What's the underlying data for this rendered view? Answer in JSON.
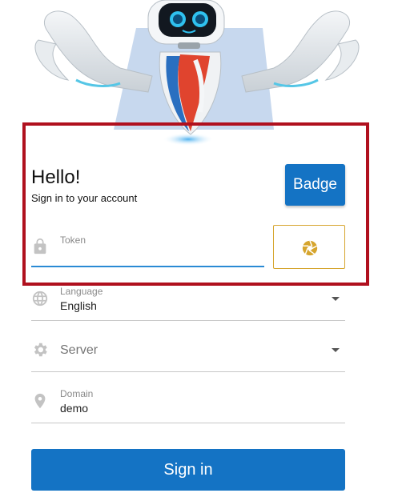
{
  "header": {
    "greeting": "Hello!",
    "subtitle": "Sign in to your account"
  },
  "badge_button": {
    "label": "Badge"
  },
  "token_field": {
    "label": "Token",
    "value": "",
    "icon": "lock-icon"
  },
  "camera_button": {
    "icon": "camera-shutter-icon"
  },
  "language_field": {
    "label": "Language",
    "value": "English",
    "icon": "globe-icon"
  },
  "server_field": {
    "placeholder": "Server",
    "value": "",
    "icon": "gear-icon"
  },
  "domain_field": {
    "label": "Domain",
    "value": "demo",
    "icon": "location-pin-icon"
  },
  "signin_button": {
    "label": "Sign in"
  },
  "colors": {
    "primary": "#1473c4",
    "highlight_frame": "#b0101e",
    "input_active": "#2a8ad4",
    "camera_accent": "#d6a52e"
  }
}
